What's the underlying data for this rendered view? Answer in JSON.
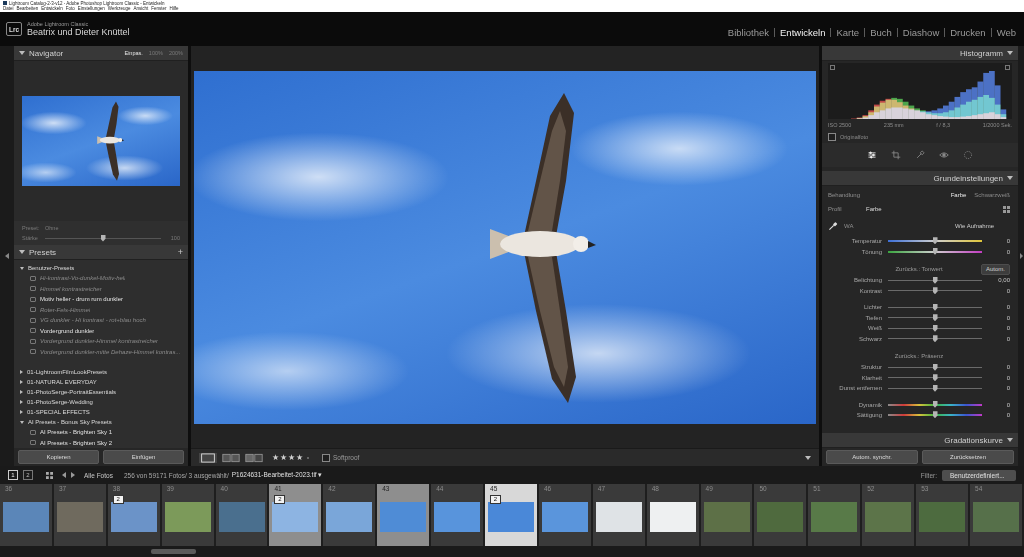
{
  "window": {
    "title": "Lightroom Catalog-2-3-v12 - Adobe Photoshop Lightroom Classic - Entwickeln"
  },
  "menu": [
    "Datei",
    "Bearbeiten",
    "Entwickeln",
    "Foto",
    "Einstellungen",
    "Werkzeuge",
    "Ansicht",
    "Fenster",
    "Hilfe"
  ],
  "identity": {
    "logo": "Lrc",
    "app": "Adobe Lightroom Classic",
    "owner": "Beatrix und Dieter Knüttel"
  },
  "modules": [
    {
      "label": "Bibliothek",
      "selected": false
    },
    {
      "label": "Entwickeln",
      "selected": true
    },
    {
      "label": "Karte",
      "selected": false
    },
    {
      "label": "Buch",
      "selected": false
    },
    {
      "label": "Diashow",
      "selected": false
    },
    {
      "label": "Drucken",
      "selected": false
    },
    {
      "label": "Web",
      "selected": false
    }
  ],
  "navigator": {
    "title": "Navigator",
    "expanded": true,
    "zoom": [
      {
        "label": "Einpas.",
        "selected": true
      },
      {
        "label": "100%",
        "selected": false
      },
      {
        "label": "200%",
        "selected": false
      }
    ]
  },
  "preset_amount": {
    "preset_label": "Preset:",
    "preset_value": "Ohne",
    "amount_label": "Stärke",
    "amount_value": "100",
    "level": 0.5
  },
  "presets": {
    "title": "Presets",
    "add": "+",
    "expanded": true,
    "groups": [
      {
        "name": "Benutzer-Presets",
        "expanded": true,
        "items": [
          {
            "name": "Hi-kontrast-Vo-dunkel-Motiv-hell",
            "dimmed": true
          },
          {
            "name": "Himmel kontrastreicher",
            "dimmed": true
          },
          {
            "name": "Motiv heller - drum rum dunkler",
            "dimmed": false
          },
          {
            "name": "Roter-Fels-Himmel",
            "dimmed": true
          },
          {
            "name": "VG dunkler - Hi kontrast - rot+blau hoch",
            "dimmed": true
          },
          {
            "name": "Vordergrund dunkler",
            "dimmed": false
          },
          {
            "name": "Vordergrund dunkler-Himmel kontrastreicher",
            "dimmed": true
          },
          {
            "name": "Vordergrund dunkler-mitte Dehaze-Himmel kontras...",
            "dimmed": true
          }
        ]
      },
      {
        "name": "01-LightroomFilmLookPresets",
        "expanded": false,
        "items": []
      },
      {
        "name": "01-NATURAL EVERYDAY",
        "expanded": false,
        "items": []
      },
      {
        "name": "01-PhotoSerge-PortraitEssentials",
        "expanded": false,
        "items": []
      },
      {
        "name": "01-PhotoSerge-Wedding",
        "expanded": false,
        "items": []
      },
      {
        "name": "01-SPECIAL EFFECTS",
        "expanded": false,
        "items": []
      },
      {
        "name": "AI Presets - Bonus Sky Presets",
        "expanded": true,
        "items": [
          {
            "name": "AI Presets - Brighten Sky 1",
            "dimmed": false
          },
          {
            "name": "AI Presets - Brighten Sky 2",
            "dimmed": false
          }
        ]
      }
    ]
  },
  "left_buttons": [
    "Kopieren",
    "Einfügen"
  ],
  "toolbar": {
    "stars": 4,
    "max": 5,
    "star_glyph": "★",
    "softproof": {
      "label": "Softproof",
      "checked": false
    }
  },
  "histogram": {
    "title": "Histogramm",
    "expanded": true,
    "series": [
      {
        "name": "red",
        "color": "#d83a3a",
        "values": [
          0,
          0,
          0,
          0,
          1,
          3,
          8,
          18,
          30,
          38,
          42,
          40,
          35,
          28,
          22,
          18,
          14,
          10,
          8,
          6,
          5,
          4,
          4,
          5,
          6,
          8,
          10,
          12,
          14,
          10,
          4,
          0
        ]
      },
      {
        "name": "green",
        "color": "#3fb53f",
        "values": [
          0,
          0,
          0,
          0,
          0,
          2,
          6,
          14,
          26,
          34,
          40,
          44,
          42,
          36,
          28,
          22,
          18,
          14,
          12,
          12,
          14,
          18,
          24,
          30,
          36,
          40,
          46,
          50,
          44,
          30,
          10,
          0
        ]
      },
      {
        "name": "blue",
        "color": "#3f6fe0",
        "values": [
          0,
          0,
          0,
          0,
          0,
          1,
          3,
          8,
          14,
          18,
          22,
          24,
          24,
          22,
          20,
          18,
          16,
          16,
          18,
          22,
          28,
          36,
          46,
          56,
          62,
          66,
          78,
          96,
          100,
          70,
          20,
          0
        ]
      }
    ],
    "info": [
      "ISO 2500",
      "235 mm",
      "f / 8,3",
      "1/2000 Sek."
    ],
    "original": {
      "label": "Originalfoto",
      "checked": false
    }
  },
  "tools": [
    {
      "name": "edit",
      "selected": true
    },
    {
      "name": "crop",
      "selected": false
    },
    {
      "name": "heal",
      "selected": false
    },
    {
      "name": "redeye",
      "selected": false
    },
    {
      "name": "mask",
      "selected": false
    }
  ],
  "basic": {
    "title": "Grundeinstellungen",
    "expanded": true,
    "treatment": {
      "label": "Behandlung",
      "options": [
        {
          "label": "Farbe",
          "selected": true
        },
        {
          "label": "Schwarzweiß",
          "selected": false
        }
      ]
    },
    "profile": {
      "label": "Profil",
      "value": "Farbe"
    },
    "wb": {
      "label": "WA",
      "value": "Wie Aufnahme"
    },
    "groups": [
      {
        "header": null,
        "sliders": [
          {
            "label": "Temperatur",
            "value": "0",
            "level": 0.5,
            "kind": "temperature"
          },
          {
            "label": "Tönung",
            "value": "0",
            "level": 0.5,
            "kind": "tint"
          }
        ]
      },
      {
        "header": {
          "label": "Zurücks.: Tonwert",
          "button": "Autom."
        },
        "sliders": [
          {
            "label": "Belichtung",
            "value": "0,00",
            "level": 0.5,
            "kind": "plain"
          },
          {
            "label": "Kontrast",
            "value": "0",
            "level": 0.5,
            "kind": "plain"
          }
        ]
      },
      {
        "header": null,
        "sliders": [
          {
            "label": "Lichter",
            "value": "0",
            "level": 0.5,
            "kind": "plain"
          },
          {
            "label": "Tiefen",
            "value": "0",
            "level": 0.5,
            "kind": "plain"
          },
          {
            "label": "Weiß",
            "value": "0",
            "level": 0.5,
            "kind": "plain"
          },
          {
            "label": "Schwarz",
            "value": "0",
            "level": 0.5,
            "kind": "plain"
          }
        ]
      },
      {
        "header": {
          "label": "Zurücks.: Präsenz",
          "button": ""
        },
        "sliders": [
          {
            "label": "Struktur",
            "value": "0",
            "level": 0.5,
            "kind": "plain"
          },
          {
            "label": "Klarheit",
            "value": "0",
            "level": 0.5,
            "kind": "plain"
          },
          {
            "label": "Dunst entfernen",
            "value": "0",
            "level": 0.5,
            "kind": "plain"
          }
        ]
      },
      {
        "header": null,
        "sliders": [
          {
            "label": "Dynamik",
            "value": "0",
            "level": 0.5,
            "kind": "vibrance"
          },
          {
            "label": "Sättigung",
            "value": "0",
            "level": 0.5,
            "kind": "saturation"
          }
        ]
      }
    ]
  },
  "curve": {
    "title": "Gradationskurve",
    "expanded": true
  },
  "right_buttons": [
    "Autom. synchr.",
    "Zurücksetzen"
  ],
  "filmstrip": {
    "screens": [
      {
        "label": "1",
        "selected": true
      },
      {
        "label": "2",
        "selected": false
      }
    ],
    "source": "Alle Fotos",
    "status": "256 von 59171 Fotos/ 3 ausgewählt/",
    "file": "P1624631-Bearbeitet-2023.tif",
    "file_arrow": "▾",
    "filter_label": "Filter:",
    "filter_value": "Benutzerdefiniert...",
    "thumbs": [
      {
        "number": "36",
        "selected": false,
        "active": false,
        "badge": "",
        "color": "#5b86b8"
      },
      {
        "number": "37",
        "selected": false,
        "active": false,
        "badge": "",
        "color": "#6f6a5e"
      },
      {
        "number": "38",
        "selected": false,
        "active": false,
        "badge": "2",
        "color": "#6b93c8"
      },
      {
        "number": "39",
        "selected": false,
        "active": false,
        "badge": "",
        "color": "#7c9a5a"
      },
      {
        "number": "40",
        "selected": false,
        "active": false,
        "badge": "",
        "color": "#4a6f8e"
      },
      {
        "number": "41",
        "selected": true,
        "active": false,
        "badge": "2",
        "color": "#8db4e2"
      },
      {
        "number": "42",
        "selected": false,
        "active": false,
        "badge": "",
        "color": "#7aa6d9"
      },
      {
        "number": "43",
        "selected": true,
        "active": false,
        "badge": "",
        "color": "#4f8cd6"
      },
      {
        "number": "44",
        "selected": false,
        "active": false,
        "badge": "",
        "color": "#5894dc"
      },
      {
        "number": "45",
        "selected": true,
        "active": true,
        "badge": "2",
        "color": "#4a88d8"
      },
      {
        "number": "46",
        "selected": false,
        "active": false,
        "badge": "",
        "color": "#5a95dc"
      },
      {
        "number": "47",
        "selected": false,
        "active": false,
        "badge": "",
        "color": "#dfe3e6"
      },
      {
        "number": "48",
        "selected": false,
        "active": false,
        "badge": "",
        "color": "#eef0f1"
      },
      {
        "number": "49",
        "selected": false,
        "active": false,
        "badge": "",
        "color": "#5d7047"
      },
      {
        "number": "50",
        "selected": false,
        "active": false,
        "badge": "",
        "color": "#4f6a3e"
      },
      {
        "number": "51",
        "selected": false,
        "active": false,
        "badge": "",
        "color": "#587a48"
      },
      {
        "number": "52",
        "selected": false,
        "active": false,
        "badge": "",
        "color": "#5c7449"
      },
      {
        "number": "53",
        "selected": false,
        "active": false,
        "badge": "",
        "color": "#4d6b3f"
      },
      {
        "number": "54",
        "selected": false,
        "active": false,
        "badge": "",
        "color": "#56704a"
      }
    ]
  },
  "scrollbar": {
    "level": 0.147
  }
}
